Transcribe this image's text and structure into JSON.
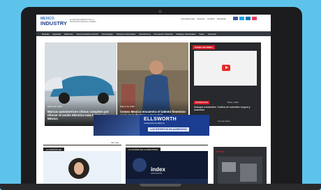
{
  "site": {
    "logo_line1": "MEXICO",
    "logo_line2": "INDUSTRY",
    "tagline": "EL ABASTECIMIENTO DE LA INDUSTRIA MANUFACTURERA"
  },
  "toplinks": [
    "Anunciarse aquí",
    "Nosotros",
    "Contacto",
    "Newsletter"
  ],
  "social_colors": [
    "#3b5998",
    "#1da1f2",
    "#0077b5",
    "#e4405f"
  ],
  "nav": [
    "Noticias",
    "Especial",
    "Webinars",
    "Documentación técnica",
    "Tecnologías",
    "Parques Industriales",
    "Nearshoring",
    "Proveedor Industrial",
    "Diálogos Industriales",
    "Video",
    "Nosotros"
  ],
  "hero": [
    {
      "date": "Marzo 22, 2024",
      "title": "Marcas automotrices chinas compiten por ofrecer el coche eléctrico más barato en México"
    },
    {
      "date": "Marzo 22, 2024",
      "title": "Cemex Mexico encuentra el talento femenino en la manufactura automotriz"
    }
  ],
  "video": {
    "badge": "CANAL DE VIDEO",
    "category": "ENTREVISTAS",
    "date": "Marzo, 2024",
    "title": "Diálogos Industriales: Cadena de suministro segura y avanzada",
    "more": "Ver más videos"
  },
  "ad": {
    "brand": "ELLSWORTH",
    "sub": "ADHESIVES DE MÉXICO",
    "tag": "LOS EXPERTOS EN ADHESIVOS"
  },
  "sections": {
    "opinion": "LA OPINIÓN DE",
    "opinion_more": "Ver más",
    "latest": "LO ÚLTIMO EN LA INDUSTRIA"
  },
  "news_card": {
    "brand": "index",
    "sub": "ASOCIACIÓN"
  },
  "ad2": {
    "brand": "sense"
  }
}
